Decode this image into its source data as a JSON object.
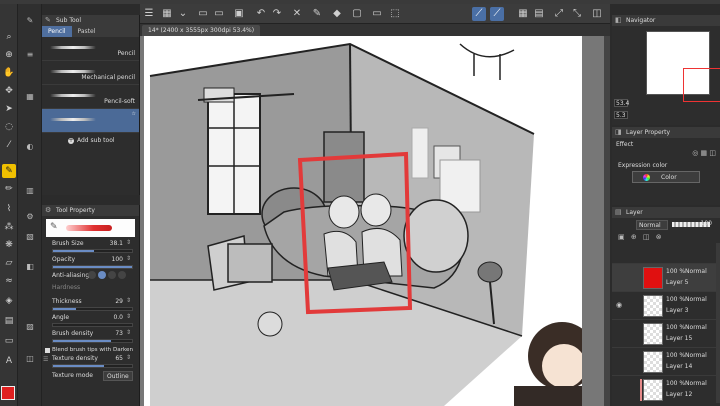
{
  "app": {
    "canvas_tab": "14* (2400 x 3555px 300dpi 53.4%)"
  },
  "subtool": {
    "title": "Sub Tool",
    "tabs": [
      "Pencil",
      "Pastel"
    ],
    "brushes": [
      {
        "name": "Pencil"
      },
      {
        "name": "Mechanical pencil"
      },
      {
        "name": "Pencil-soft"
      },
      {
        "name": "",
        "badge": "☆"
      }
    ],
    "add_label": "Add sub tool"
  },
  "toolprop": {
    "title": "Tool Property",
    "brush_size_label": "Brush Size",
    "brush_size": "38.1",
    "brush_size_fraction": 0.52,
    "opacity_label": "Opacity",
    "opacity": "100",
    "opacity_fraction": 1.0,
    "antialias_label": "Anti-aliasing",
    "hardness_label": "Hardness",
    "thickness_label": "Thickness",
    "thickness": "29",
    "thickness_fraction": 0.29,
    "angle_label": "Angle",
    "angle": "0.0",
    "angle_fraction": 0.0,
    "density_label": "Brush density",
    "density": "73",
    "density_fraction": 0.73,
    "blend_label": "Blend brush tips with Darken",
    "texture_density_label": "Texture density",
    "texture_density": "65",
    "texture_density_fraction": 0.65,
    "texture_mode_label": "Texture mode",
    "texture_mode": "Outline"
  },
  "navigator": {
    "title": "Navigator",
    "zoom": "53.4",
    "rotate": "5.3"
  },
  "layer_property": {
    "title": "Layer Property",
    "effect_label": "Effect",
    "expression_label": "Expression color",
    "expression_value": "Color"
  },
  "layers": {
    "title": "Layer",
    "blend_mode": "Normal",
    "opacity": "100",
    "items": [
      {
        "mode": "100 %Normal",
        "name": "Layer 5",
        "thumb": "red",
        "selected": true
      },
      {
        "mode": "100 %Normal",
        "name": "Layer 3",
        "thumb": "check",
        "selected": false
      },
      {
        "mode": "100 %Normal",
        "name": "Layer 15",
        "thumb": "check",
        "selected": false
      },
      {
        "mode": "100 %Normal",
        "name": "Layer 14",
        "thumb": "check",
        "selected": false
      },
      {
        "mode": "100 %Normal",
        "name": "Layer 12",
        "thumb": "check",
        "selected": false
      }
    ]
  },
  "colors": {
    "main_color": "#e02020",
    "accent": "#4a6fa5",
    "active_tool": "#f0c000"
  }
}
